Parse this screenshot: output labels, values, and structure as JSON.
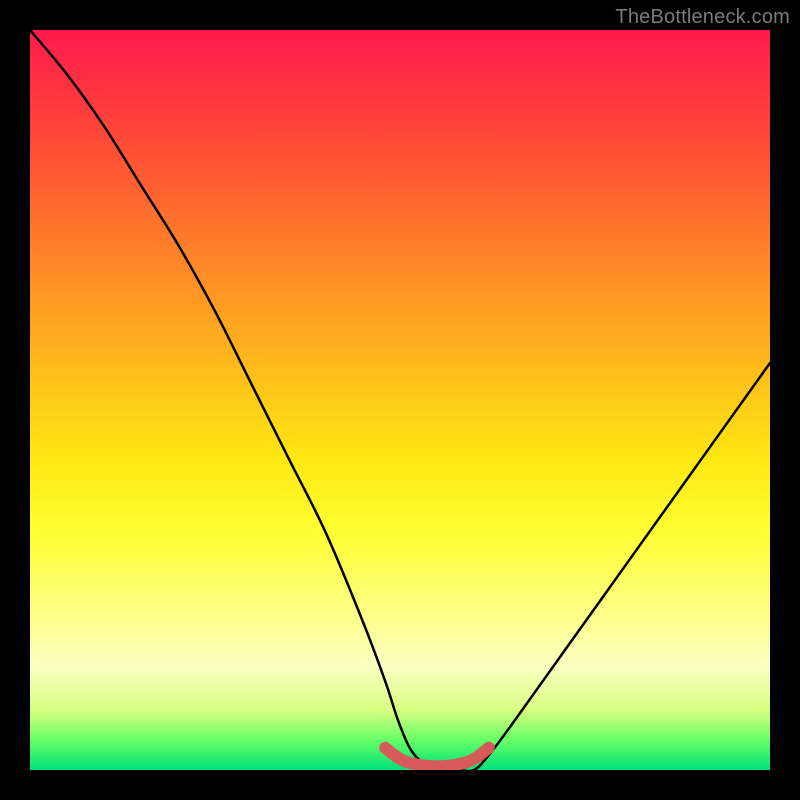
{
  "watermark": "TheBottleneck.com",
  "chart_data": {
    "type": "line",
    "title": "",
    "xlabel": "",
    "ylabel": "",
    "x_range": [
      0,
      100
    ],
    "y_range": [
      0,
      100
    ],
    "note": "A curve resembling bottleneck mismatch percentage. Y≈100 near x=0, drops steeply and curves down to ~0 over x≈50–60 (flat valley), then rises roughly linearly to ~55 at x=100. A short thick pink segment marks the valley floor.",
    "series": [
      {
        "name": "curve",
        "x": [
          0,
          5,
          10,
          15,
          20,
          25,
          30,
          35,
          40,
          45,
          48,
          50,
          52,
          55,
          58,
          60,
          62,
          65,
          70,
          75,
          80,
          85,
          90,
          95,
          100
        ],
        "y": [
          100,
          94,
          87,
          79,
          71,
          62,
          52,
          42,
          32,
          20,
          12,
          6,
          2,
          0,
          0,
          0,
          2,
          6,
          13,
          20,
          27,
          34,
          41,
          48,
          55
        ]
      },
      {
        "name": "valley-marker",
        "x": [
          48,
          50,
          52,
          55,
          58,
          60,
          62
        ],
        "y": [
          3,
          1.5,
          0.8,
          0.5,
          0.8,
          1.5,
          3
        ]
      }
    ],
    "colors": {
      "curve": "#000000",
      "valley": "#d65a5a"
    }
  }
}
